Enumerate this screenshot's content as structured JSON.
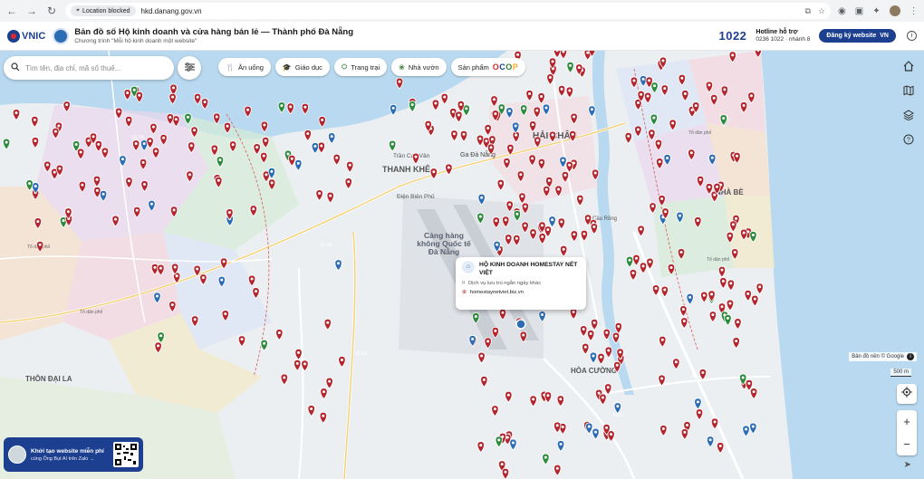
{
  "browser": {
    "location_blocked": "Location blocked",
    "url": "hkd.danang.gov.vn"
  },
  "header": {
    "logo_text": "VNIC",
    "title": "Bản đồ số Hộ kinh doanh và cửa hàng bán lẻ — Thành phố Đà Nẵng",
    "subtitle": "Chương trình \"Mỗi hộ kinh doanh một website\"",
    "brand_1022": "1022",
    "hotline_label": "Hotline hỗ trợ",
    "hotline_number": "0236 1022 · nhánh 8",
    "register_label": "Đăng ký website",
    "register_flag": "VN"
  },
  "search": {
    "placeholder": "Tìm tên, địa chỉ, mã số thuế..."
  },
  "categories": [
    {
      "label": "Ăn uống",
      "icon": "fork-knife-icon"
    },
    {
      "label": "Giáo dục",
      "icon": "graduation-cap-icon"
    },
    {
      "label": "Trang trại",
      "icon": "farm-icon"
    },
    {
      "label": "Nhà vườn",
      "icon": "garden-icon"
    },
    {
      "label": "Sản phẩm",
      "icon": "product-icon"
    }
  ],
  "ocop": [
    "O",
    "C",
    "O",
    "P"
  ],
  "map_labels": [
    "HẢI CHÂU",
    "THANH KHÊ",
    "Ga Đà Nẵng",
    "Trần Cao Vân",
    "Điện Biên Phủ",
    "Cảng hàng không Quốc tế Đà Nẵng",
    "Cầu Rồng",
    "NHÀ BÈ",
    "HÒA CƯỜNG",
    "THÔN ĐẠI LA",
    "QL1A",
    "QL14",
    "AH17",
    "Tổ dân phố"
  ],
  "popup": {
    "name": "HỘ KINH DOANH HOMESTAY NÉT VIỆT",
    "category": "Dịch vụ lưu trú ngắn ngày khác",
    "website": "homestaynetviet.biz.vn"
  },
  "map_controls": {
    "attribution": "Bản đồ nền © Google",
    "scale": "500 m"
  },
  "promo": {
    "title": "Khởi tạo website miễn phí",
    "subtitle": "cùng Ông Bụt AI trên Zalo →"
  },
  "colors": {
    "brand_blue": "#1c3f8f",
    "marker_red": "#b3262e",
    "marker_blue": "#2c6cb3",
    "marker_green": "#2e8b3e",
    "water": "#b8d9ef"
  }
}
